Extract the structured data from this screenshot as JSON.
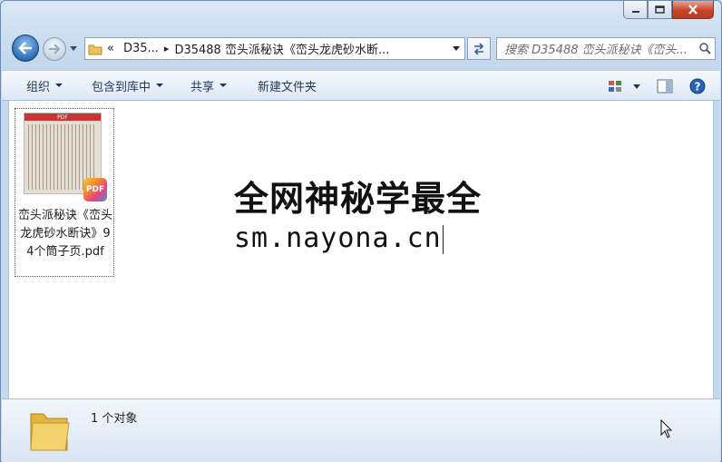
{
  "window": {
    "minimize_icon": "minimize-icon",
    "maximize_icon": "maximize-icon",
    "close_icon": "close-icon"
  },
  "nav": {
    "crumb_overflow": "«",
    "crumbs": [
      "D35...",
      "D35488 峦头派秘诀《峦头龙虎砂水断..."
    ],
    "search_placeholder": "搜索 D35488 峦头派秘诀《峦头..."
  },
  "toolbar": {
    "organize": "组织",
    "include_in_library": "包含到库中",
    "share": "共享",
    "new_folder": "新建文件夹"
  },
  "file": {
    "name": "峦头派秘诀《峦头龙虎砂水断诀》94个筒子页.pdf",
    "badge": "PDF",
    "thumb_header": "PDF"
  },
  "watermark": {
    "line1": "全网神秘学最全",
    "line2": "sm.nayona.cn"
  },
  "details": {
    "count": "1 个对象"
  },
  "colors": {
    "accent": "#2d6eb8",
    "close_button": "#c8452c"
  }
}
